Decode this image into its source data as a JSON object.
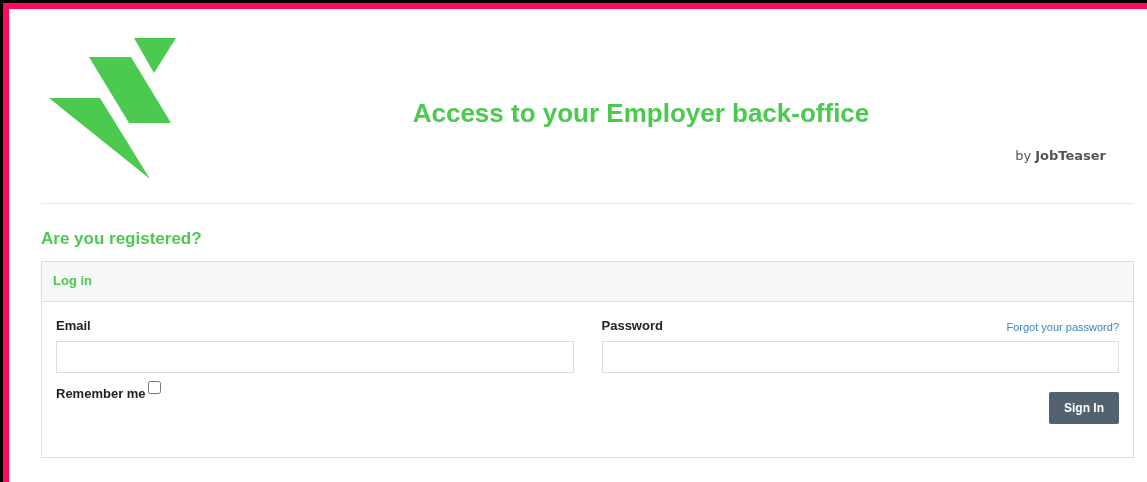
{
  "header": {
    "title": "Access to your Employer back-office",
    "byline": "by **JobTeaser**"
  },
  "section_title": "Are you registered?",
  "panel": {
    "title": "Log in",
    "email": {
      "label": "Email"
    },
    "password": {
      "label": "Password",
      "link": "Forgot your password?"
    },
    "remember": {
      "label": "Remember me",
      "checked": false
    },
    "submit": "Sign In"
  }
}
